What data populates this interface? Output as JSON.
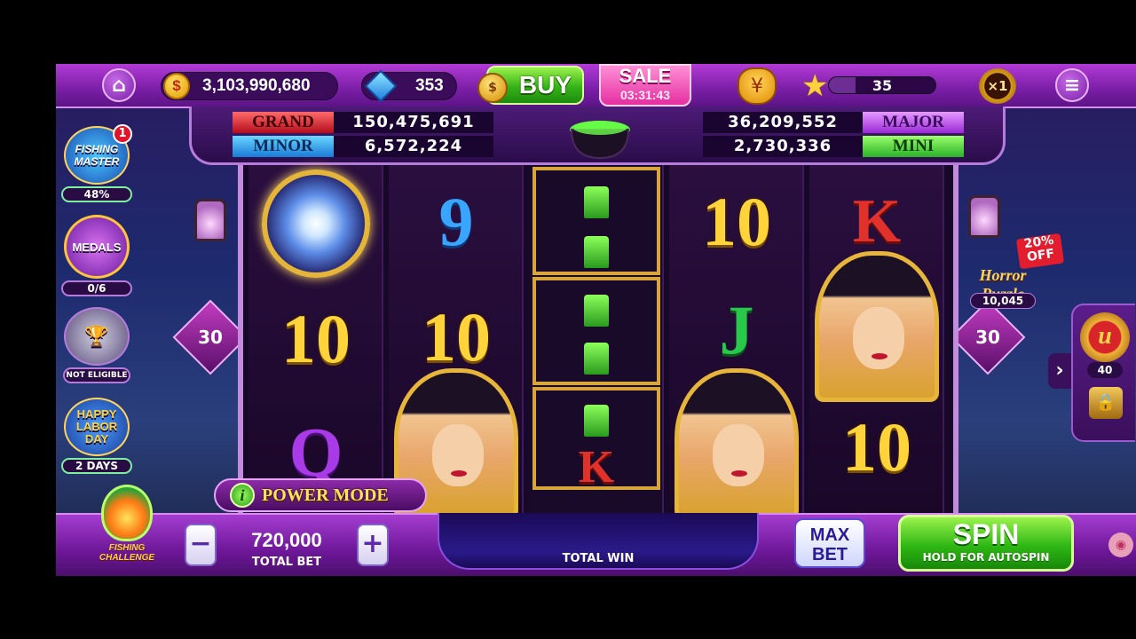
{
  "topbar": {
    "coins": "3,103,990,680",
    "coin_icon": "dollar-coin-icon",
    "gems": "353",
    "buy_label": "BUY",
    "sale_label": "SALE",
    "sale_timer": "03:31:43",
    "level": "35",
    "level_progress": 0.25,
    "multiplier": "×1"
  },
  "jackpots": {
    "grand_label": "GRAND",
    "grand_value": "150,475,691",
    "minor_label": "MINOR",
    "minor_value": "6,572,224",
    "major_value": "36,209,552",
    "major_label": "MAJOR",
    "mini_value": "2,730,336",
    "mini_label": "MINI"
  },
  "left_panel": {
    "fishing_master_label": "FISHING MASTER",
    "fishing_master_badge": "1",
    "fishing_master_progress": "48%",
    "medals_label": "MEDALS",
    "medals_progress": "0/6",
    "not_eligible_label": "NOT ELIGIBLE",
    "labor_day_label": "HAPPY LABOR DAY",
    "labor_day_remaining": "2 DAYS",
    "fishing_challenge_label": "FISHING CHALLENGE"
  },
  "paylines": {
    "left": "30",
    "right": "30"
  },
  "right_panel": {
    "discount": "20% OFF",
    "puzzle_title": "Horror Puzzle",
    "puzzle_value": "10,045",
    "u_badge": "u",
    "u_count": "40"
  },
  "reels": [
    [
      "orb",
      "10",
      "Q"
    ],
    [
      "9",
      "10",
      "witch"
    ],
    [
      "candles"
    ],
    [
      "10",
      "J",
      "witch"
    ],
    [
      "K",
      "witch",
      "10"
    ]
  ],
  "power_mode_label": "POWER MODE",
  "bottombar": {
    "bet_value": "720,000",
    "bet_label": "TOTAL BET",
    "minus": "−",
    "plus": "+",
    "total_win_label": "TOTAL WIN",
    "max_bet_line1": "MAX",
    "max_bet_line2": "BET",
    "spin_label": "SPIN",
    "spin_sub": "HOLD FOR AUTOSPIN"
  }
}
